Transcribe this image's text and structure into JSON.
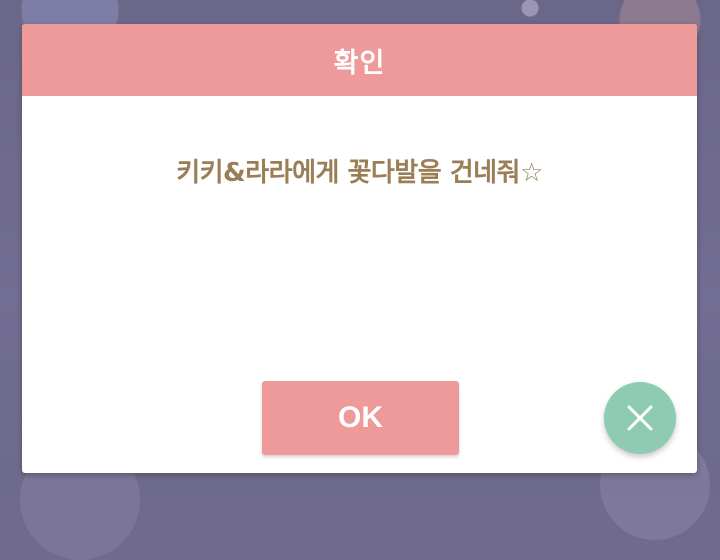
{
  "dialog": {
    "title": "확인",
    "message": "키키&라라에게 꽃다발을 건네줘☆",
    "ok_label": "OK"
  },
  "icons": {
    "close": "close-icon"
  },
  "colors": {
    "header": "#ef9a9a",
    "ok_button": "#ef9a9a",
    "message_text": "#9b7e56",
    "close_button": "#8fcab2"
  }
}
